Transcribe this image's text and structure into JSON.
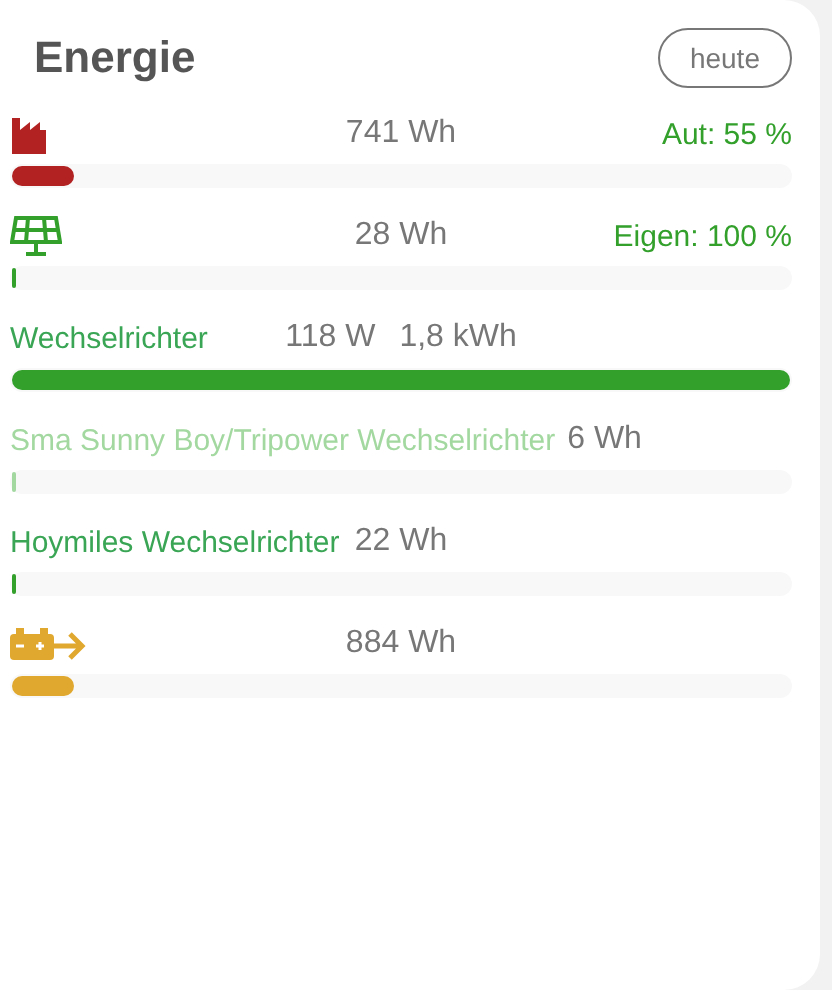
{
  "title": "Energie",
  "period_button": "heute",
  "rows": [
    {
      "kind": "grid",
      "value": "741 Wh",
      "note": "Aut: 55 %",
      "level": 0.08,
      "color": "#b22222"
    },
    {
      "kind": "solar",
      "value": "28 Wh",
      "note": "Eigen: 100 %",
      "level": 0.005,
      "color": "#33a02c"
    },
    {
      "kind": "inverter",
      "name": "Wechselrichter",
      "value": "118 W",
      "value_2": "1,8 kWh",
      "level": 1,
      "color": "#33a02c",
      "dimmed": false
    },
    {
      "kind": "inverter",
      "name": "Sma Sunny Boy/Tripower Wechselrichter",
      "value": "6 Wh",
      "level": 0.005,
      "color": "#a3d9a0",
      "dimmed": true
    },
    {
      "kind": "inverter",
      "name": "Hoymiles Wechselrichter",
      "value": "22 Wh",
      "level": 0.005,
      "color": "#33a02c",
      "dimmed": false
    },
    {
      "kind": "battery",
      "value": "884 Wh",
      "level": 0.08,
      "color": "#e0a82e"
    }
  ]
}
